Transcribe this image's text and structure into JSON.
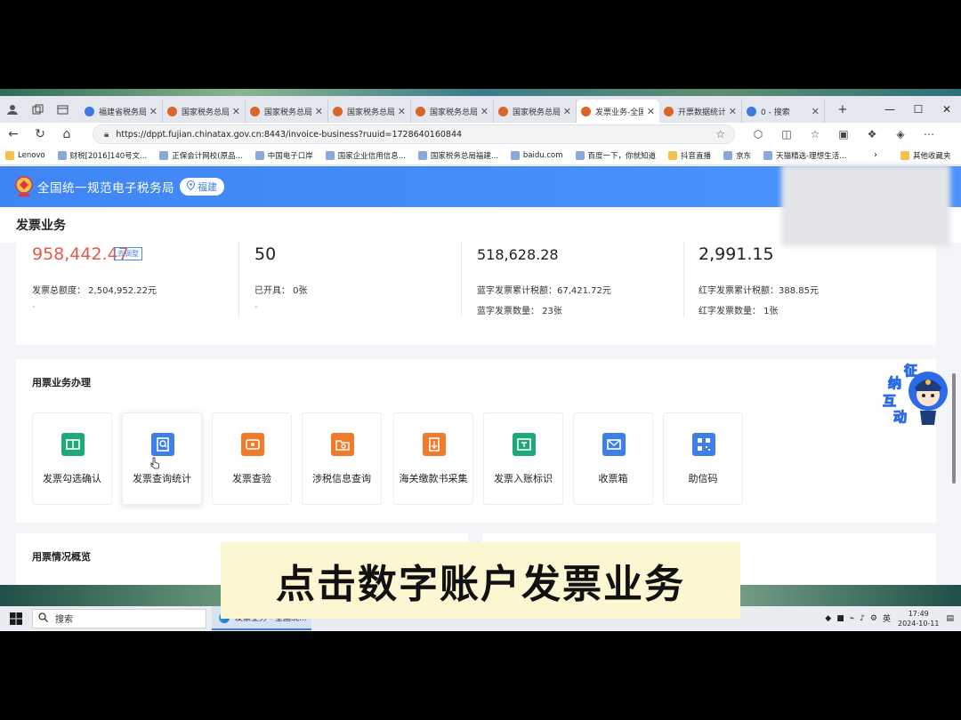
{
  "browser": {
    "tabs": [
      {
        "title": "福建省税务局",
        "active": false,
        "color": "#3c78e0"
      },
      {
        "title": "国家税务总局",
        "active": false,
        "color": "#d9652b"
      },
      {
        "title": "国家税务总局",
        "active": false,
        "color": "#d9652b"
      },
      {
        "title": "国家税务总局",
        "active": false,
        "color": "#d9652b"
      },
      {
        "title": "国家税务总局",
        "active": false,
        "color": "#d9652b"
      },
      {
        "title": "国家税务总局",
        "active": false,
        "color": "#d9652b"
      },
      {
        "title": "发票业务-全国",
        "active": true,
        "color": "#d9652b"
      },
      {
        "title": "开票数据统计",
        "active": false,
        "color": "#d9652b"
      },
      {
        "title": "0 - 搜索",
        "active": false,
        "color": "#3c78e0"
      }
    ],
    "new_tab": "+",
    "url": "https://dppt.fujian.chinatax.gov.cn:8443/invoice-business?ruuid=1728640160844",
    "bookmarks": [
      {
        "label": "Lenovo",
        "kind": "folder"
      },
      {
        "label": "财税[2016]140号文...",
        "kind": "page"
      },
      {
        "label": "正保会计网校(原品...",
        "kind": "page"
      },
      {
        "label": "中国电子口岸",
        "kind": "page"
      },
      {
        "label": "国家企业信用信息...",
        "kind": "page"
      },
      {
        "label": "国家税务总局福建...",
        "kind": "page"
      },
      {
        "label": "baidu.com",
        "kind": "page"
      },
      {
        "label": "百度一下，你就知道",
        "kind": "page"
      },
      {
        "label": "抖音直播",
        "kind": "folder"
      },
      {
        "label": "京东",
        "kind": "page"
      },
      {
        "label": "天猫精选-理想生活...",
        "kind": "page"
      }
    ],
    "other_bookmarks": "其他收藏夹"
  },
  "header": {
    "title": "全国统一规范电子税务局",
    "region": "福建"
  },
  "page": {
    "title": "发票业务"
  },
  "summary": [
    {
      "big": "958,442.47",
      "adjust": "去调整",
      "lines": [
        "发票总额度：  2,504,952.22元"
      ],
      "dash": "-"
    },
    {
      "big": "50",
      "lines": [
        "已开具：  0张"
      ],
      "dash": "-"
    },
    {
      "big": "518,628.28",
      "lines": [
        "蓝字发票累计税额：67,421.72元",
        "蓝字发票数量：  23张"
      ]
    },
    {
      "big": "2,991.15",
      "lines": [
        "红字发票累计税额：388.85元",
        "红字发票数量：  1张"
      ]
    }
  ],
  "services": {
    "title": "用票业务办理",
    "items": [
      {
        "label": "发票勾选确认",
        "color": "#1fa97a",
        "icon": "ticket-icon"
      },
      {
        "label": "发票查询统计",
        "color": "#3f7fe8",
        "icon": "search-doc-icon"
      },
      {
        "label": "发票查验",
        "color": "#f07b2b",
        "icon": "verify-icon"
      },
      {
        "label": "涉税信息查询",
        "color": "#f07b2b",
        "icon": "folder-search-icon"
      },
      {
        "label": "海关缴款书采集",
        "color": "#f07b2b",
        "icon": "download-doc-icon"
      },
      {
        "label": "发票入账标识",
        "color": "#1fa97a",
        "icon": "ledger-icon"
      },
      {
        "label": "收票箱",
        "color": "#3f7fe8",
        "icon": "mail-icon"
      },
      {
        "label": "助信码",
        "color": "#3f7fe8",
        "icon": "qr-icon"
      }
    ]
  },
  "usage": {
    "title": "用票情况概览"
  },
  "assistant": {
    "chars": [
      "征",
      "纳",
      "互",
      "动"
    ]
  },
  "caption": "点击数字账户发票业务",
  "taskbar": {
    "search": "搜索",
    "app": "发票业务 - 全国统...",
    "time": "17:49",
    "date": "2024-10-11",
    "ime": "英"
  }
}
